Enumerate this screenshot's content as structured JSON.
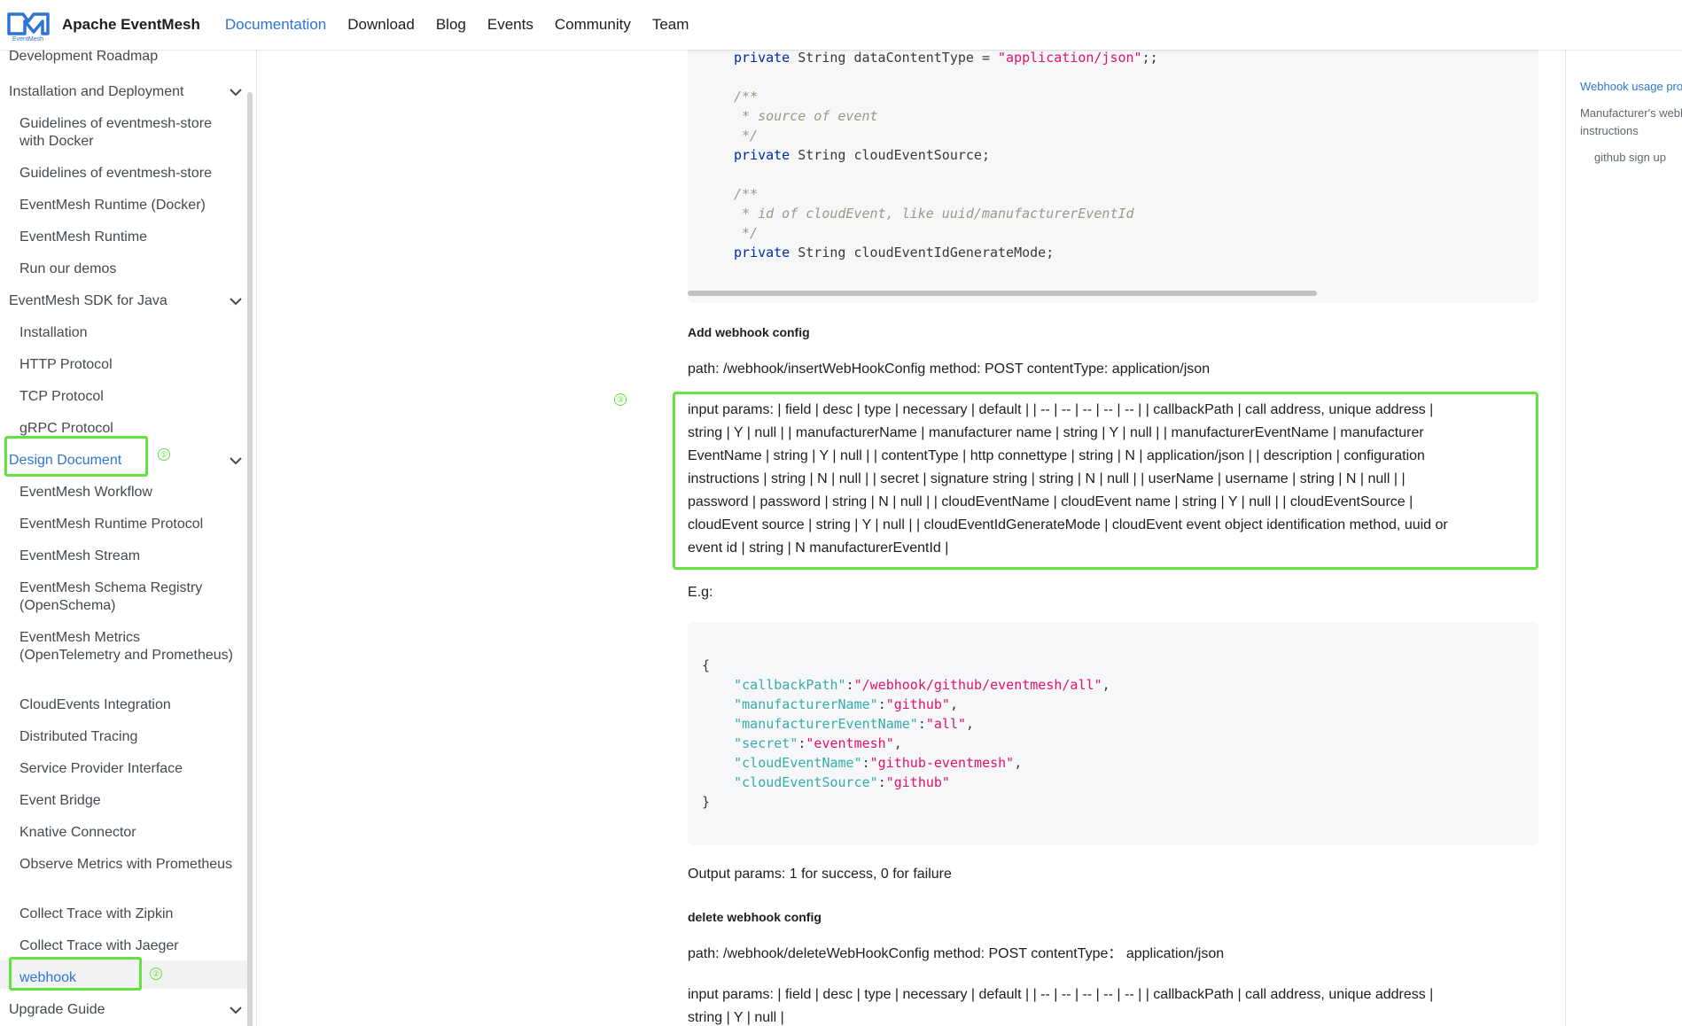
{
  "navbar": {
    "brand": "Apache EventMesh",
    "logo_text": "EventMesh",
    "links": [
      "Documentation",
      "Download",
      "Blog",
      "Events",
      "Community",
      "Team"
    ]
  },
  "sidebar": {
    "items": [
      "Development Roadmap",
      "Installation and Deployment",
      "Guidelines of eventmesh-store with Docker",
      "Guidelines of eventmesh-store",
      "EventMesh Runtime (Docker)",
      "EventMesh Runtime",
      "Run our demos",
      "EventMesh SDK for Java",
      "Installation",
      "HTTP Protocol",
      "TCP Protocol",
      "gRPC Protocol",
      "Design Document",
      "EventMesh Workflow",
      "EventMesh Runtime Protocol",
      "EventMesh Stream",
      "EventMesh Schema Registry (OpenSchema)",
      "EventMesh Metrics (OpenTelemetry and Prometheus)",
      "CloudEvents Integration",
      "Distributed Tracing",
      "Service Provider Interface",
      "Event Bridge",
      "Knative Connector",
      "Observe Metrics with Prometheus",
      "Collect Trace with Zipkin",
      "Collect Trace with Jaeger",
      "webhook",
      "Upgrade Guide"
    ],
    "markers": [
      "①",
      "②"
    ]
  },
  "code1": {
    "l1_kw": "private",
    "l1_txt": " String dataContentType = ",
    "l1_str": "\"application/json\"",
    "l1_end": ";;",
    "c1a": "/**",
    "c1b": " * source of event",
    "c1c": " */",
    "l2_kw": "private",
    "l2_txt": " String cloudEventSource;",
    "c2a": "/**",
    "c2b": " * id of cloudEvent, like uuid/manufacturerEventId",
    "c2c": " */",
    "l3_kw": "private",
    "l3_txt": " String cloudEventIdGenerateMode;"
  },
  "content": {
    "add_title": "Add webhook config",
    "add_path": "path: /webhook/insertWebHookConfig method: POST contentType: application/json",
    "marker3": "③",
    "params_lines": [
      "input params: | field | desc | type |    necessary | default    | | -- | -- | -- | -- | -- | | callbackPath | call address, unique address |",
      "string | Y    | null    | | manufacturerName | manufacturer name | string | Y    | null    | | manufacturerEventName | manufacturer",
      "EventName | string | Y    | null    | | contentType | http connettype | string | N    | application/json    | | description | configuration",
      "instructions | string | N    | null    | | secret | signature string | string | N    | null    | | userName | username | string | N    | null    | |",
      "password | password | string | N    | null    | | cloudEventName | cloudEvent name | string | Y    | null    | | cloudEventSource |",
      "cloudEvent source | string | Y    | null    | | cloudEventIdGenerateMode | cloudEvent event object identification method, uuid or",
      "event id | string | N manufacturerEventId    |"
    ],
    "eg": "E.g:",
    "output": "Output params: 1 for success, 0 for failure",
    "delete_title": "delete webhook config",
    "delete_path": "path: /webhook/deleteWebHookConfig method: POST contentType：  application/json",
    "delete_params_1": "input params: | field | desc | type |    necessary | default    | | -- | -- | -- | -- | -- | | callbackPath | call address, unique address |",
    "delete_params_2": "string | Y    | null    |"
  },
  "code2": {
    "open": "{",
    "k1": "\"callbackPath\"",
    "v1": "\"/webhook/github/eventmesh/all\"",
    "k2": "\"manufacturerName\"",
    "v2": "\"github\"",
    "k3": "\"manufacturerEventName\"",
    "v3": "\"all\"",
    "k4": "\"secret\"",
    "v4": "\"eventmesh\"",
    "k5": "\"cloudEventName\"",
    "v5": "\"github-eventmesh\"",
    "k6": "\"cloudEventSource\"",
    "v6": "\"github\"",
    "close": "}"
  },
  "toc": {
    "items": [
      "Webhook usage process",
      "Manufacturer's webhook",
      "instructions",
      "github sign up"
    ]
  },
  "colors": {
    "accent": "#2e74d6",
    "highlight": "#62e33f"
  }
}
